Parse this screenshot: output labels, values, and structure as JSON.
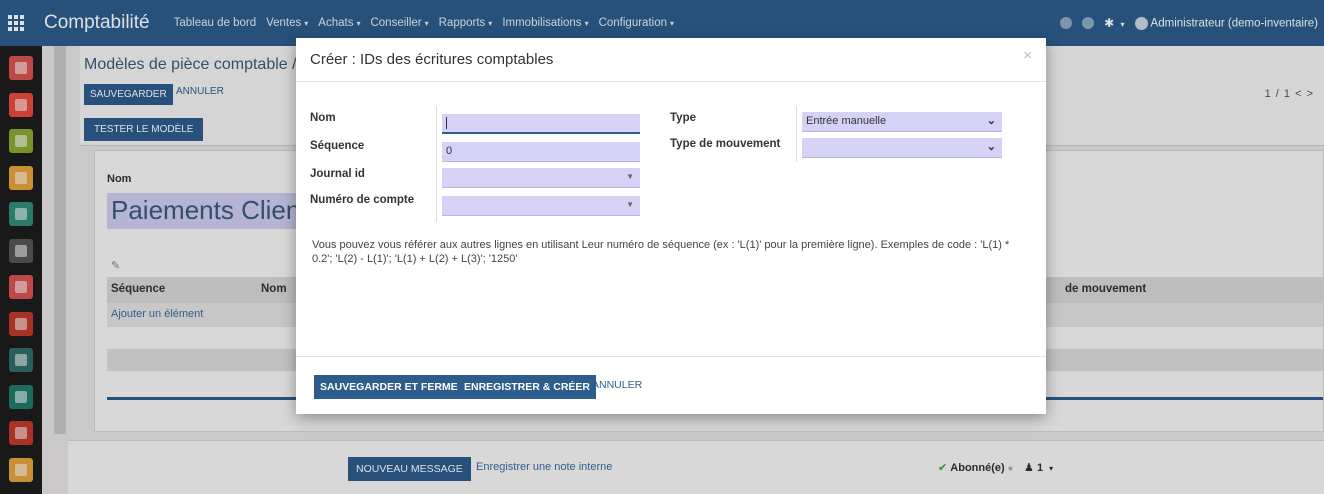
{
  "app": {
    "name": "Comptabilité"
  },
  "nav": {
    "menus": [
      {
        "label": "Tableau de bord",
        "caret": false
      },
      {
        "label": "Ventes",
        "caret": true
      },
      {
        "label": "Achats",
        "caret": true
      },
      {
        "label": "Conseiller",
        "caret": true
      },
      {
        "label": "Rapports",
        "caret": true
      },
      {
        "label": "Immobilisations",
        "caret": true
      },
      {
        "label": "Configuration",
        "caret": true
      }
    ],
    "user": "Administrateur (demo-inventaire)"
  },
  "sidebar_apps": [
    {
      "name": "discuss",
      "color": "#d9534f"
    },
    {
      "name": "mail",
      "color": "#e84a3d"
    },
    {
      "name": "calendar",
      "color": "#8aa832"
    },
    {
      "name": "maps",
      "color": "#e6a23c"
    },
    {
      "name": "contacts",
      "color": "#2f8c7a"
    },
    {
      "name": "inventory",
      "color": "#555555"
    },
    {
      "name": "invoicing",
      "color": "#d9534f"
    },
    {
      "name": "accounting",
      "color": "#c0392b"
    },
    {
      "name": "reporting",
      "color": "#2f6b6b"
    },
    {
      "name": "sheet",
      "color": "#1f7a6b"
    },
    {
      "name": "website",
      "color": "#c0392b"
    },
    {
      "name": "documents",
      "color": "#e6a23c"
    }
  ],
  "form": {
    "breadcrumb": "Modèles de pièce comptable / P",
    "save_label": "Sauvegarder",
    "discard_label": "Annuler",
    "pager": "1 / 1  <  >",
    "test_label": "Tester le modèle",
    "name_label": "Nom",
    "name_value": "Paiements Clien",
    "edit_icon": "✎",
    "table": {
      "col_sequence": "Séquence",
      "col_name": "Nom",
      "col_move": "de mouvement",
      "add_item": "Ajouter un élément"
    }
  },
  "chatter": {
    "new_message": "Nouveau message",
    "log_note": "Enregistrer une note interne",
    "check": "✔",
    "follow": "Abonné(e)",
    "bell": "🔔",
    "followers": "1"
  },
  "modal": {
    "title": "Créer : IDs des écritures comptables",
    "close": "×",
    "fields": {
      "nom_label": "Nom",
      "nom_value": "",
      "sequence_label": "Séquence",
      "sequence_value": "0",
      "journal_label": "Journal id",
      "journal_value": "",
      "account_label": "Numéro de compte",
      "account_value": "",
      "type_label": "Type",
      "type_value": "Entrée manuelle",
      "move_type_label": "Type de mouvement",
      "move_type_value": ""
    },
    "help_text": "Vous pouvez vous référer aux autres lignes en utilisant Leur numéro de séquence (ex : 'L(1)' pour la première ligne). Exemples de code : 'L(1) * 0.2'; 'L(2) - L(1)'; 'L(1) + L(2) + L(3)'; '1250'",
    "save_close": "Sauvegarder et fermer",
    "save_new": "Enregistrer & créer",
    "cancel": "Annuler"
  }
}
